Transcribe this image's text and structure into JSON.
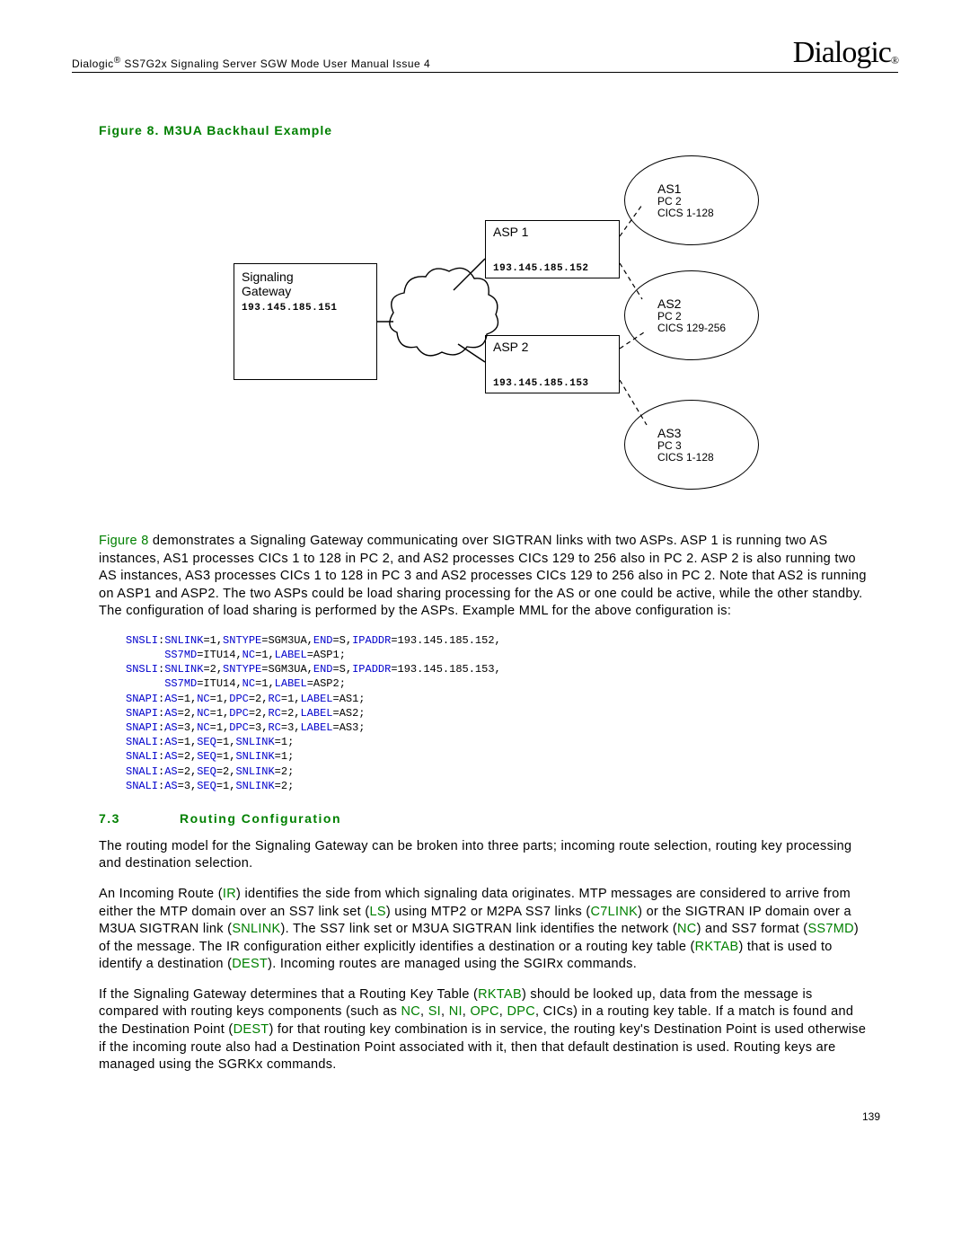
{
  "header": {
    "doc_title_prefix": "Dialogic",
    "doc_title_suffix": " SS7G2x Signaling Server SGW Mode User Manual  Issue 4",
    "logo_text": "Dialogic",
    "logo_reg": "®"
  },
  "figure": {
    "caption": "Figure 8. M3UA Backhaul Example",
    "sgw": {
      "label1": "Signaling",
      "label2": "Gateway",
      "ip": "193.145.185.151"
    },
    "asp1": {
      "label": "ASP 1",
      "ip": "193.145.185.152"
    },
    "asp2": {
      "label": "ASP 2",
      "ip": "193.145.185.153"
    },
    "as1": {
      "name": "AS1",
      "pc": "PC 2",
      "cics": "CICS 1-128"
    },
    "as2": {
      "name": "AS2",
      "pc": "PC 2",
      "cics": "CICS 129-256"
    },
    "as3": {
      "name": "AS3",
      "pc": "PC 3",
      "cics": "CICS 1-128"
    }
  },
  "para1": {
    "p1a": "Figure 8",
    "p1b": " demonstrates a Signaling Gateway communicating over SIGTRAN links with two ASPs. ASP 1 is running two AS instances, AS1 processes CICs 1 to 128 in PC 2, and AS2 processes CICs 129 to 256 also in PC 2. ASP 2 is also running two AS instances, AS3 processes CICs 1 to 128 in PC 3 and AS2 processes CICs 129 to 256 also in PC 2. Note that AS2 is running on ASP1 and ASP2. The two ASPs could be load sharing processing for the AS or one could be active, while the other standby. The configuration of load sharing is performed by the ASPs. Example MML for the above configuration is:"
  },
  "code": {
    "l1a": "SNSLI",
    "l1b": ":",
    "l1c": "SNLINK",
    "l1d": "=1,",
    "l1e": "SNTYPE",
    "l1f": "=SGM3UA,",
    "l1g": "END",
    "l1h": "=S,",
    "l1i": "IPADDR",
    "l1j": "=193.145.185.152,",
    "l2a": "      ",
    "l2b": "SS7MD",
    "l2c": "=ITU14,",
    "l2d": "NC",
    "l2e": "=1,",
    "l2f": "LABEL",
    "l2g": "=ASP1;",
    "l3a": "SNSLI",
    "l3b": ":",
    "l3c": "SNLINK",
    "l3d": "=2,",
    "l3e": "SNTYPE",
    "l3f": "=SGM3UA,",
    "l3g": "END",
    "l3h": "=S,",
    "l3i": "IPADDR",
    "l3j": "=193.145.185.153,",
    "l4a": "      ",
    "l4b": "SS7MD",
    "l4c": "=ITU14,",
    "l4d": "NC",
    "l4e": "=1,",
    "l4f": "LABEL",
    "l4g": "=ASP2;",
    "l5a": "SNAPI",
    "l5b": ":",
    "l5c": "AS",
    "l5d": "=1,",
    "l5e": "NC",
    "l5f": "=1,",
    "l5g": "DPC",
    "l5h": "=2,",
    "l5i": "RC",
    "l5j": "=1,",
    "l5k": "LABEL",
    "l5l": "=AS1;",
    "l6a": "SNAPI",
    "l6b": ":",
    "l6c": "AS",
    "l6d": "=2,",
    "l6e": "NC",
    "l6f": "=1,",
    "l6g": "DPC",
    "l6h": "=2,",
    "l6i": "RC",
    "l6j": "=2,",
    "l6k": "LABEL",
    "l6l": "=AS2;",
    "l7a": "SNAPI",
    "l7b": ":",
    "l7c": "AS",
    "l7d": "=3,",
    "l7e": "NC",
    "l7f": "=1,",
    "l7g": "DPC",
    "l7h": "=3,",
    "l7i": "RC",
    "l7j": "=3,",
    "l7k": "LABEL",
    "l7l": "=AS3;",
    "l8a": "SNALI",
    "l8b": ":",
    "l8c": "AS",
    "l8d": "=1,",
    "l8e": "SEQ",
    "l8f": "=1,",
    "l8g": "SNLINK",
    "l8h": "=1;",
    "l9a": "SNALI",
    "l9b": ":",
    "l9c": "AS",
    "l9d": "=2,",
    "l9e": "SEQ",
    "l9f": "=1,",
    "l9g": "SNLINK",
    "l9h": "=1;",
    "l10a": "SNALI",
    "l10b": ":",
    "l10c": "AS",
    "l10d": "=2,",
    "l10e": "SEQ",
    "l10f": "=2,",
    "l10g": "SNLINK",
    "l10h": "=2;",
    "l11a": "SNALI",
    "l11b": ":",
    "l11c": "AS",
    "l11d": "=3,",
    "l11e": "SEQ",
    "l11f": "=1,",
    "l11g": "SNLINK",
    "l11h": "=2;"
  },
  "section": {
    "num": "7.3",
    "title": "Routing Configuration"
  },
  "para2": "The routing model for the Signaling Gateway can be broken into three parts; incoming route selection, routing key processing and destination selection.",
  "para3": {
    "t1": "An Incoming Route (",
    "ir": "IR",
    "t2": ") identifies the side from which signaling data originates. MTP messages are considered to arrive from either the MTP domain over an SS7 link set (",
    "ls": "LS",
    "t3": ") using MTP2 or M2PA SS7 links (",
    "c7": "C7LINK",
    "t4": ") or the SIGTRAN IP domain over a M3UA SIGTRAN link (",
    "sn": "SNLINK",
    "t5": "). The SS7 link set or M3UA SIGTRAN link identifies the network (",
    "nc": "NC",
    "t6": ") and SS7 format (",
    "md": "SS7MD",
    "t7": ") of the message. The IR configuration either explicitly identifies a destination or a routing key table (",
    "rk": "RKTAB",
    "t8": ") that is used to identify a destination (",
    "de": "DEST",
    "t9": "). Incoming routes are managed using the SGIRx commands."
  },
  "para4": {
    "t1": "If the Signaling Gateway determines that a Routing Key Table (",
    "rk": "RKTAB",
    "t2": ") should be looked up, data from the message is compared with routing keys components (such as ",
    "nc": "NC",
    "c1": ", ",
    "si": "SI",
    "c2": ", ",
    "ni": "NI",
    "c3": ", ",
    "opc": "OPC",
    "c4": ", ",
    "dpc": "DPC",
    "t3": ", CICs) in a routing key table. If a match is found and the Destination Point (",
    "de": "DEST",
    "t4": ") for that routing key combination is in service, the routing key's Destination Point is used otherwise if the incoming route also had a Destination Point associated with it, then that default destination is used. Routing keys are managed using the SGRKx commands."
  },
  "footer": {
    "page": "139"
  }
}
